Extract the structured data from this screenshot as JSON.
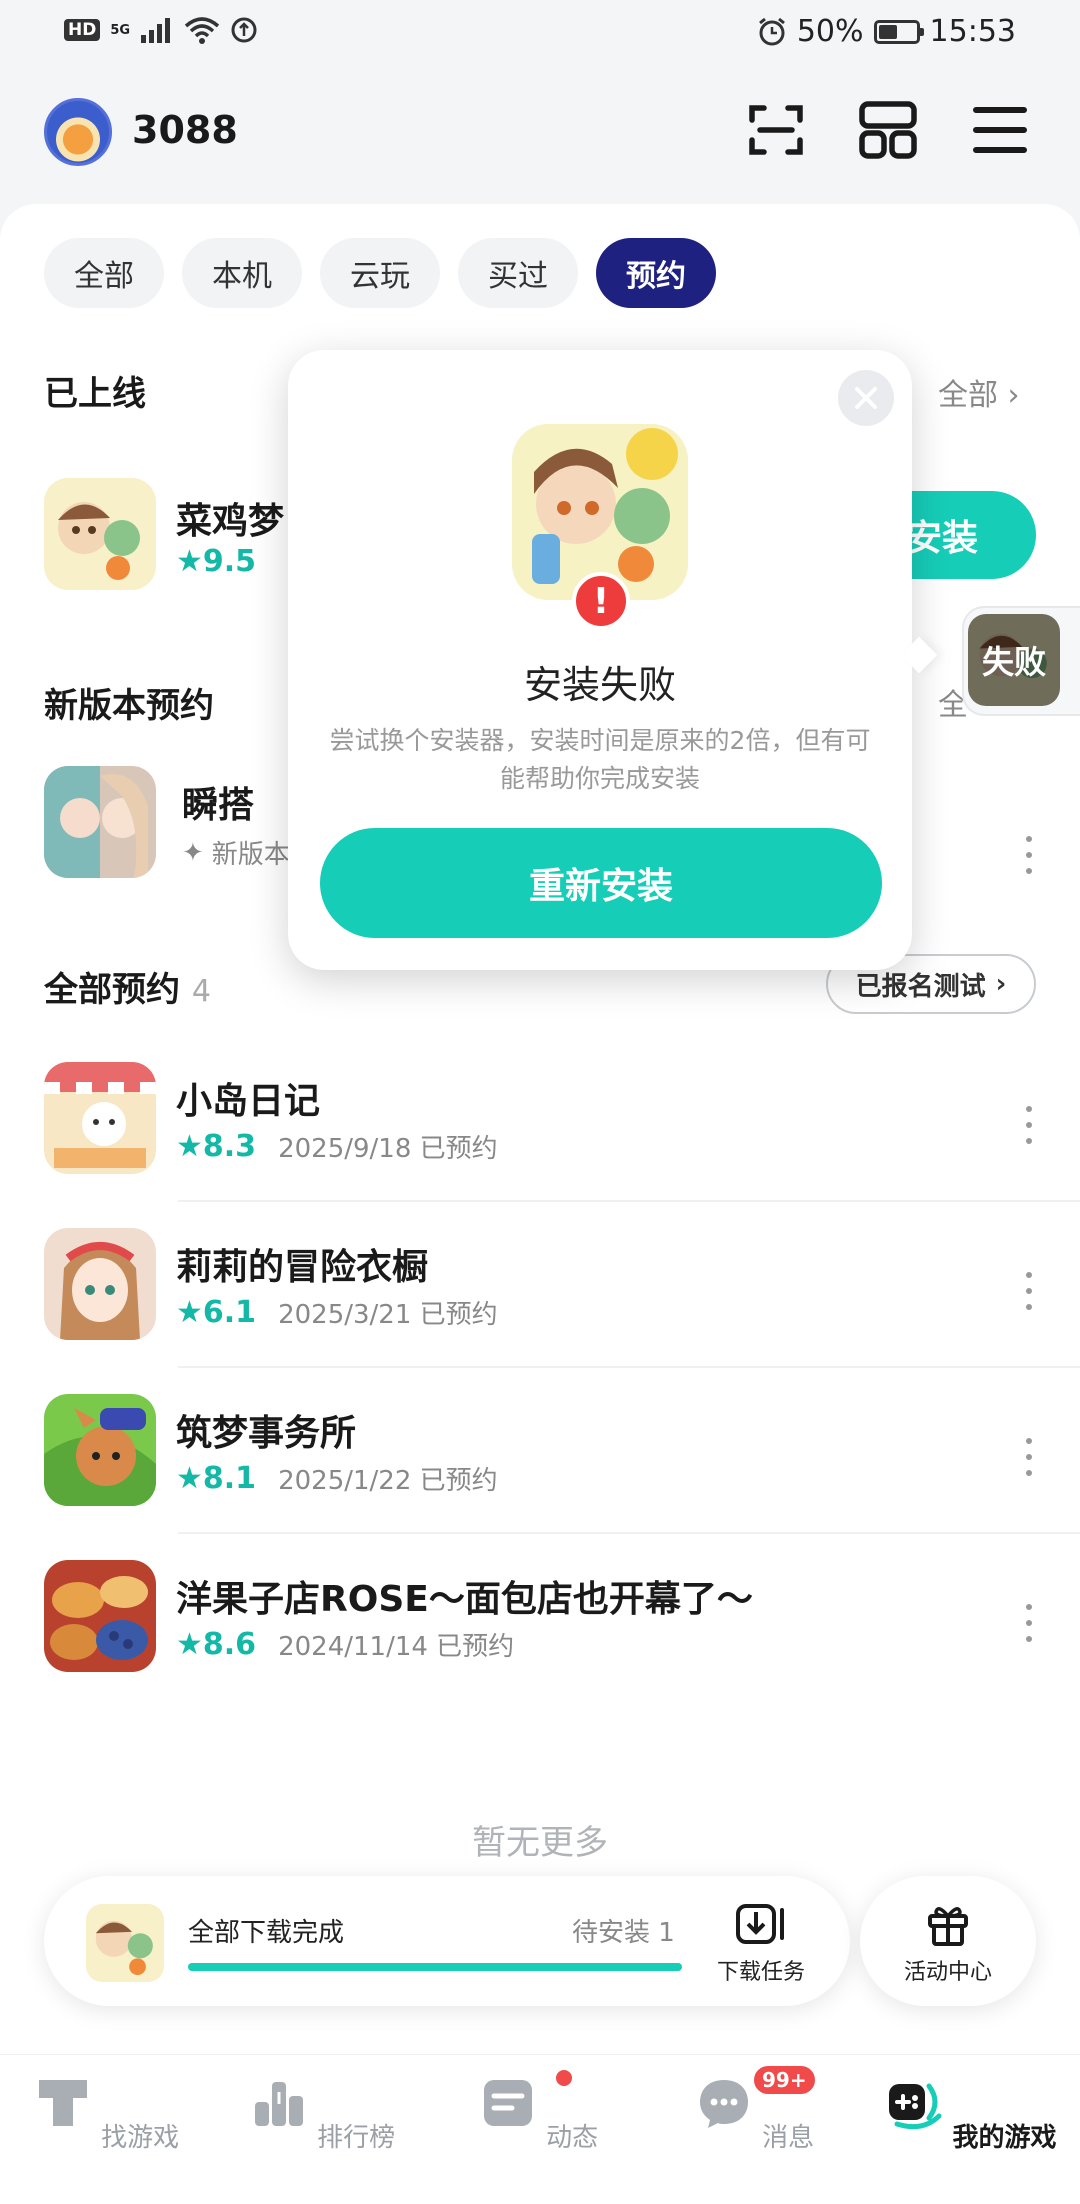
{
  "status_bar": {
    "hd": "HD",
    "network": "5G",
    "battery": "50%",
    "time": "15:53"
  },
  "header": {
    "coins": "3088",
    "icons": [
      "scan-icon",
      "apps-grid-icon",
      "menu-icon"
    ]
  },
  "filters": [
    {
      "label": "全部",
      "active": false
    },
    {
      "label": "本机",
      "active": false
    },
    {
      "label": "云玩",
      "active": false
    },
    {
      "label": "买过",
      "active": false
    },
    {
      "label": "预约",
      "active": true
    }
  ],
  "online": {
    "title": "已上线",
    "all_link": "全部",
    "app": {
      "name": "菜鸡梦",
      "rating": "9.5",
      "install_label": "安装"
    }
  },
  "new_version": {
    "title": "新版本预约",
    "all_link": "全",
    "app": {
      "name": "瞬搭",
      "sub": "新版本"
    }
  },
  "all_reserved": {
    "title": "全部预约",
    "count": "4",
    "signup_label": "已报名测试",
    "items": [
      {
        "name": "小岛日记",
        "rating": "8.3",
        "date": "2025/9/18 已预约"
      },
      {
        "name": "莉莉的冒险衣橱",
        "rating": "6.1",
        "date": "2025/3/21 已预约"
      },
      {
        "name": "筑梦事务所",
        "rating": "8.1",
        "date": "2025/1/22 已预约"
      },
      {
        "name": "洋果子店ROSE～面包店也开幕了～",
        "rating": "8.6",
        "date": "2024/11/14 已预约"
      }
    ]
  },
  "no_more": "暂无更多",
  "download_bar": {
    "title": "全部下载完成",
    "pending": "待安装 1",
    "progress": 1.0,
    "task_label": "下载任务",
    "activity_label": "活动中心"
  },
  "bottom_nav": [
    {
      "label": "找游戏",
      "icon": "find-game-icon",
      "active": false
    },
    {
      "label": "排行榜",
      "icon": "ranking-icon",
      "active": false
    },
    {
      "label": "动态",
      "icon": "feed-icon",
      "active": false
    },
    {
      "label": "消息",
      "icon": "message-icon",
      "active": false,
      "badge": "99+"
    },
    {
      "label": "我的游戏",
      "icon": "my-games-icon",
      "active": true
    }
  ],
  "popup": {
    "title": "安装失败",
    "description": "尝试换个安装器，安装时间是原来的2倍，但有可能帮助你完成安装",
    "button": "重新安装",
    "badge": "!"
  },
  "fail_float": {
    "label": "失败"
  },
  "colors": {
    "accent": "#16cdb8",
    "chip_active": "#1e2180",
    "error": "#ee3b3b",
    "rating": "#14b8a6"
  }
}
